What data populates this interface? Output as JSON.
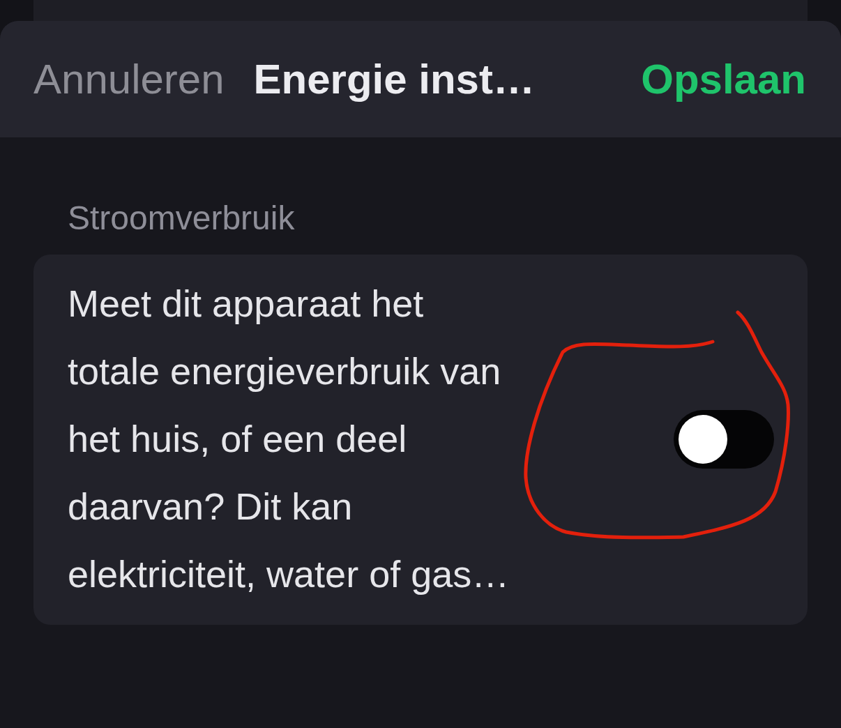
{
  "header": {
    "cancel": "Annuleren",
    "title": "Energie inst…",
    "save": "Opslaan"
  },
  "section": {
    "label": "Stroomverbruik",
    "description": "Meet dit apparaat het totale energieverbruik van het huis, of een deel daarvan? Dit kan elektriciteit, water of gas…",
    "toggle": {
      "on": false
    }
  }
}
